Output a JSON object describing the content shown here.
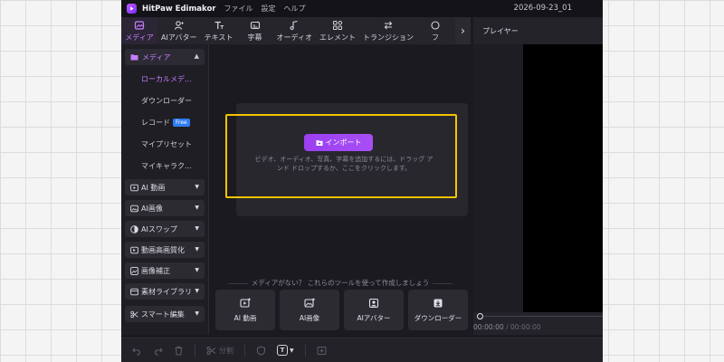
{
  "app": {
    "name": "HitPaw Edimakor",
    "menus": [
      "ファイル",
      "設定",
      "ヘルプ"
    ],
    "project_name": "2026-09-23_01"
  },
  "toolbar": {
    "tabs": [
      {
        "label": "メディア",
        "icon": "media-icon",
        "active": true
      },
      {
        "label": "AIアバター",
        "icon": "ai-avatar-icon"
      },
      {
        "label": "テキスト",
        "icon": "text-icon"
      },
      {
        "label": "字幕",
        "icon": "subtitle-icon"
      },
      {
        "label": "オーディオ",
        "icon": "audio-icon"
      },
      {
        "label": "エレメント",
        "icon": "element-icon"
      },
      {
        "label": "トランジション",
        "icon": "transition-icon"
      },
      {
        "label": "フ",
        "icon": "filter-icon"
      }
    ],
    "next_icon": "chevron-right-icon"
  },
  "sidebar": {
    "header": "メディア",
    "sub_items": [
      {
        "label": "ローカルメデ...",
        "active": true
      },
      {
        "label": "ダウンローダー"
      },
      {
        "label": "レコード",
        "badge": "Free"
      },
      {
        "label": "マイプリセット"
      },
      {
        "label": "マイキャラク..."
      }
    ],
    "groups": [
      {
        "label": "AI 動画",
        "icon": "ai-video-icon"
      },
      {
        "label": "AI画像",
        "icon": "ai-image-icon"
      },
      {
        "label": "AIスワップ",
        "icon": "ai-swap-icon"
      },
      {
        "label": "動画高画質化",
        "icon": "enhance-icon"
      },
      {
        "label": "画像補正",
        "icon": "image-correct-icon"
      },
      {
        "label": "素材ライブラリ",
        "icon": "library-icon"
      },
      {
        "label": "スマート編集",
        "icon": "smart-edit-icon"
      }
    ]
  },
  "media": {
    "import_button": "インポート",
    "hint": "ビデオ、オーディオ、写真、字幕を追加するには、ドラッグ アンド ドロップするか、ここをクリックします。",
    "tools_label": "メディアがない？ これらのツールを使って作成しましょう",
    "tools": [
      {
        "label": "AI 動画",
        "icon": "ai-video-add-icon"
      },
      {
        "label": "AI画像",
        "icon": "ai-image-add-icon"
      },
      {
        "label": "AIアバター",
        "icon": "ai-avatar-card-icon"
      },
      {
        "label": "ダウンローダー",
        "icon": "download-icon"
      }
    ]
  },
  "player": {
    "title": "プレイヤー",
    "time_current": "00:00:00",
    "time_separator": " / ",
    "time_total": "00:00:00"
  },
  "bottom_toolbar": {
    "split_label": "分割",
    "text_button": "T"
  },
  "colors": {
    "accent": "#c77dff",
    "highlight_border": "#f5c400",
    "import_button": "#9b3ff0"
  }
}
